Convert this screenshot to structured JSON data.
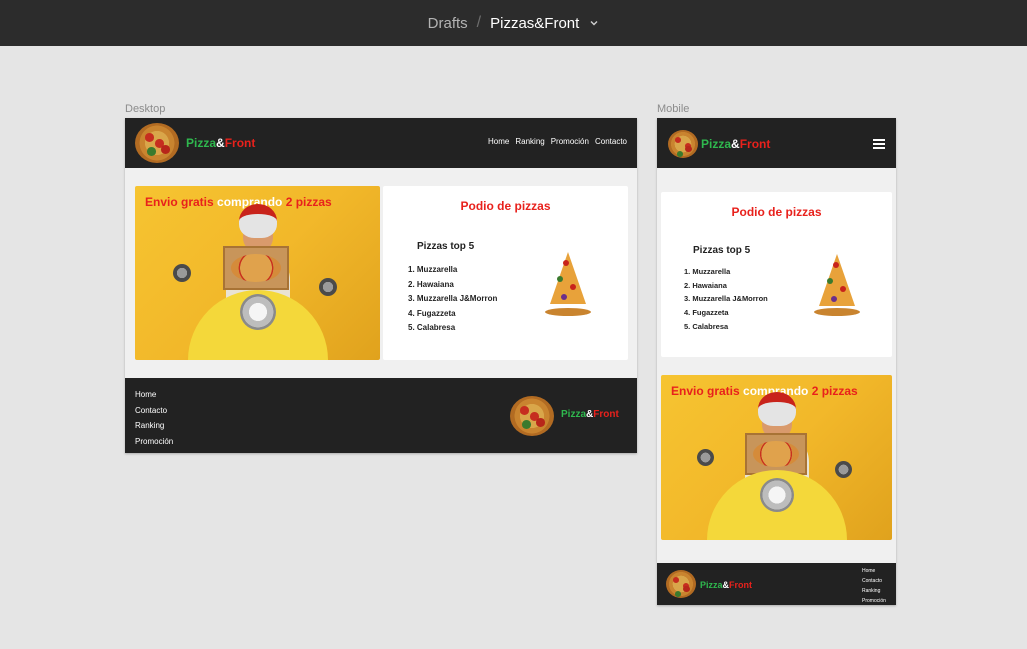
{
  "topbar": {
    "drafts": "Drafts",
    "separator": "/",
    "file_name": "Pizzas&Front"
  },
  "frames": {
    "desktop_label": "Desktop",
    "mobile_label": "Mobile"
  },
  "brand": {
    "pizza": "Pizza",
    "amp": "&",
    "front": "Front"
  },
  "nav": {
    "items": [
      "Home",
      "Ranking",
      "Promoción",
      "Contacto"
    ]
  },
  "promo": {
    "part1": "Envio gratis ",
    "part2": "comprando",
    "part3": " 2 pizzas"
  },
  "podium": {
    "title": "Podio de pizzas",
    "subtitle": "Pizzas top 5",
    "items": [
      "1. Muzzarella",
      "2. Hawaiana",
      "3. Muzzarella J&Morron",
      "4. Fugazzeta",
      "5. Calabresa"
    ]
  },
  "footer": {
    "links": [
      "Home",
      "Contacto",
      "Ranking",
      "Promoción"
    ]
  },
  "colors": {
    "green": "#2fb84e",
    "red": "#e8211c",
    "dark": "#222222",
    "hero_yellow": "#f2b82a"
  }
}
